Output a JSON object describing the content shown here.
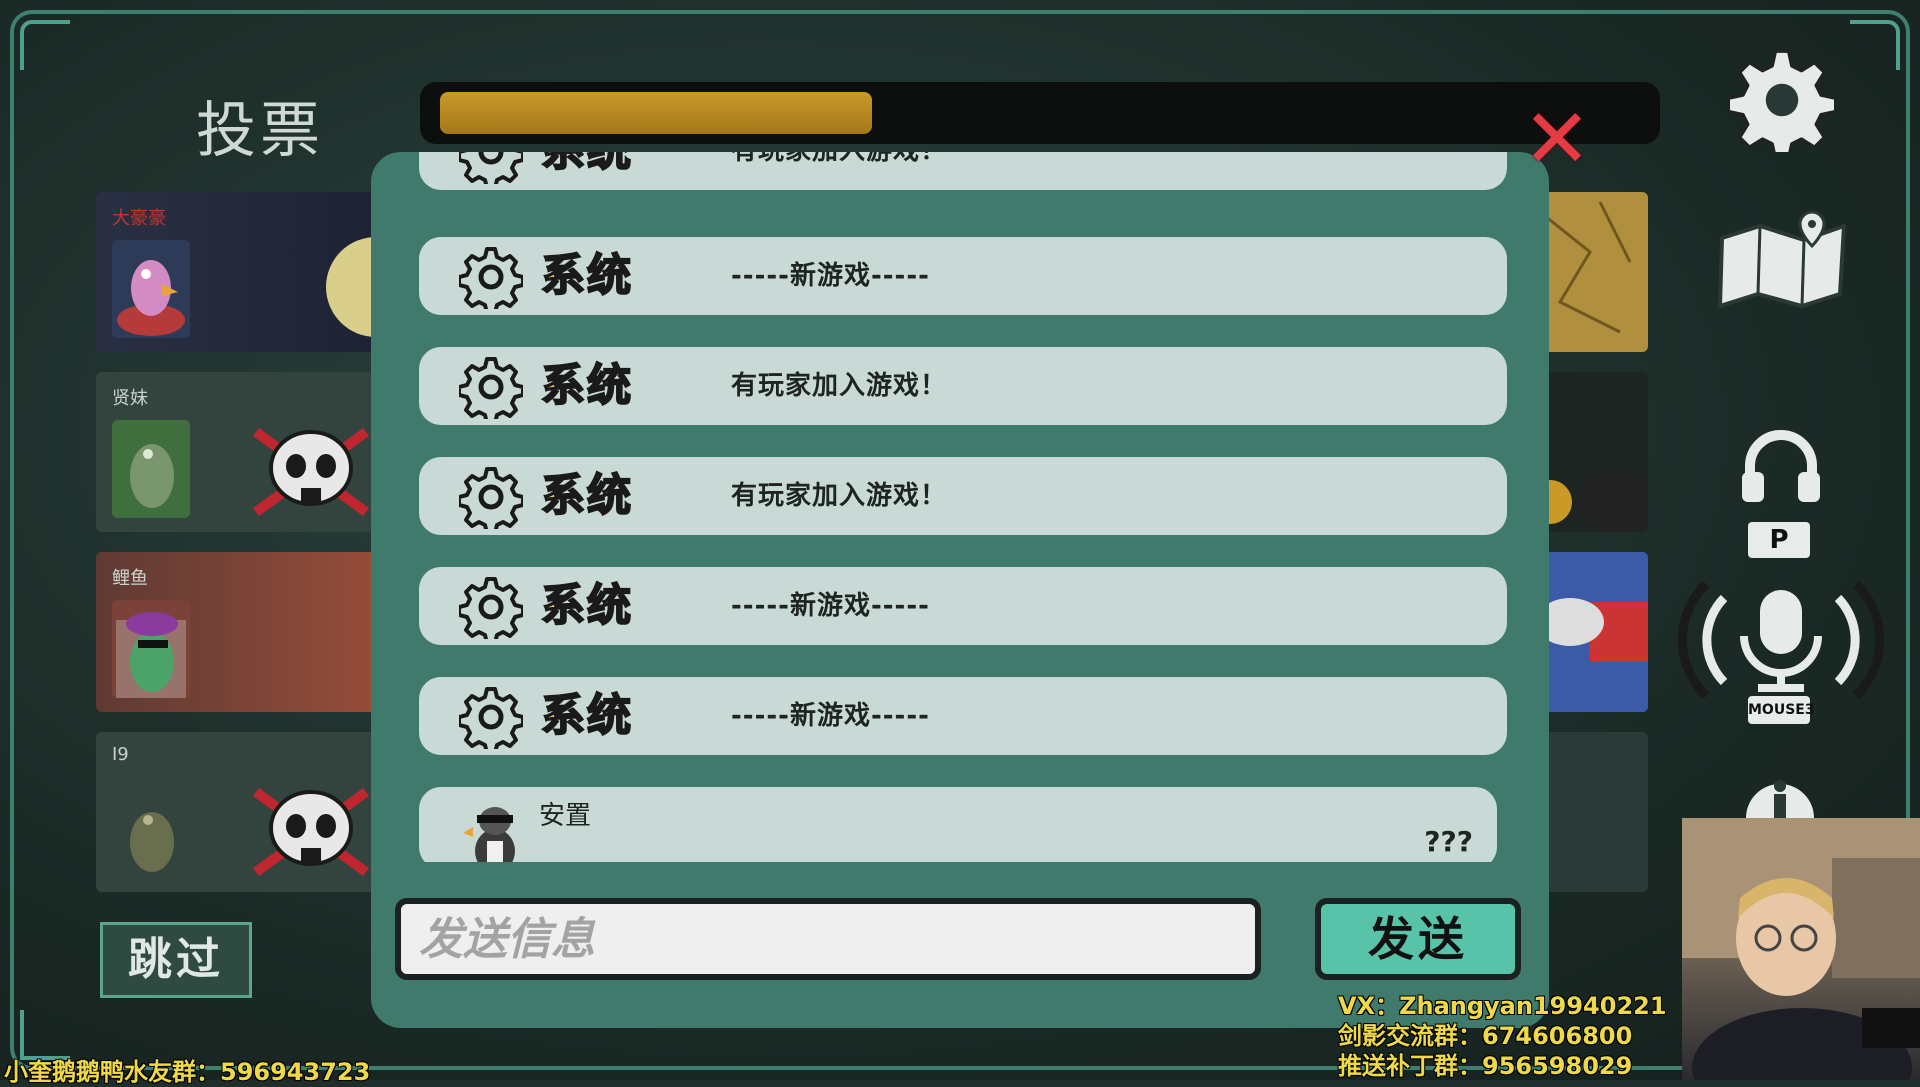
{
  "header": {
    "title": "投票",
    "timer_fraction": 0.36
  },
  "players_left": [
    {
      "name": "大豪豪",
      "dead": false
    },
    {
      "name": "贤妹",
      "dead": true
    },
    {
      "name": "鲤鱼",
      "dead": false
    },
    {
      "name": "I9",
      "dead": true
    }
  ],
  "chat": {
    "messages": [
      {
        "type": "system",
        "sender": "系统",
        "text": "有玩家加入游戏！"
      },
      {
        "type": "system",
        "sender": "系统",
        "text": "-----新游戏-----"
      },
      {
        "type": "system",
        "sender": "系统",
        "text": "有玩家加入游戏！"
      },
      {
        "type": "system",
        "sender": "系统",
        "text": "有玩家加入游戏！"
      },
      {
        "type": "system",
        "sender": "系统",
        "text": "-----新游戏-----"
      },
      {
        "type": "system",
        "sender": "系统",
        "text": "-----新游戏-----"
      },
      {
        "type": "player",
        "sender": "安置",
        "text": "???"
      }
    ],
    "input_placeholder": "发送信息",
    "send_label": "发送"
  },
  "skip_label": "跳过",
  "keys": {
    "push_to_talk": "P",
    "voice": "MOUSE3"
  },
  "stream_overlay": {
    "vx": "VX：Zhangyan19940221",
    "group1": "剑影交流群：674606800",
    "group2": "推送补丁群：956598029",
    "qq_group": "小奎鹅鹅鸭水友群：596943723"
  },
  "colors": {
    "panel": "#3f7a6c",
    "message_bg": "#c9dad6",
    "sender": "#f2e35c",
    "send_button": "#59c3aa",
    "timer": "#b8891f",
    "close": "#e53b44"
  }
}
